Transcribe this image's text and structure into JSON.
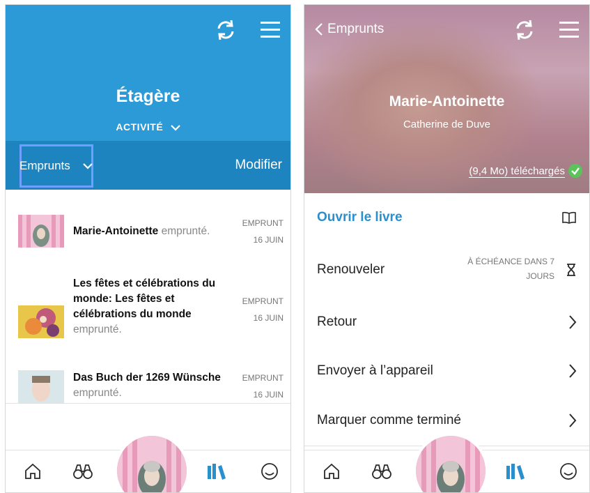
{
  "left": {
    "title": "Étagère",
    "activity_label": "ACTIVITÉ",
    "filter_label": "Emprunts",
    "modify_label": "Modifier",
    "items": [
      {
        "title": "Marie-Antoinette",
        "suffix": "emprunté.",
        "status": "EMPRUNT",
        "date": "16 JUIN"
      },
      {
        "title": "Les fêtes et célébrations du monde: Les fêtes et célébrations du monde",
        "suffix": "emprunté.",
        "status": "EMPRUNT",
        "date": "16 JUIN"
      },
      {
        "title": "Das Buch der 1269 Wünsche",
        "suffix": "emprunté.",
        "status": "EMPRUNT",
        "date": "16 JUIN"
      }
    ]
  },
  "right": {
    "back_label": "Emprunts",
    "book_title": "Marie-Antoinette",
    "author": "Catherine de Duve",
    "download_status": "(9,4 Mo) téléchargés",
    "actions": {
      "open": "Ouvrir le livre",
      "renew": "Renouveler",
      "renew_due_line1": "À ÉCHÉANCE DANS 7",
      "renew_due_line2": "JOURS",
      "return": "Retour",
      "send": "Envoyer à l’appareil",
      "mark_done": "Marquer comme terminé"
    }
  },
  "icons": [
    "sync-icon",
    "menu-icon",
    "chevron-down-icon",
    "chevron-left-icon",
    "home-icon",
    "binoculars-icon",
    "shelf-icon",
    "smiley-icon",
    "book-icon",
    "hourglass-icon",
    "chevron-right-icon",
    "check-icon"
  ],
  "colors": {
    "header_blue": "#2b9ad6",
    "subbar_blue": "#1d84bf",
    "accent_blue": "#2b8fcd",
    "highlight_border": "#6fa0ff",
    "check_green": "#5bc35b"
  }
}
